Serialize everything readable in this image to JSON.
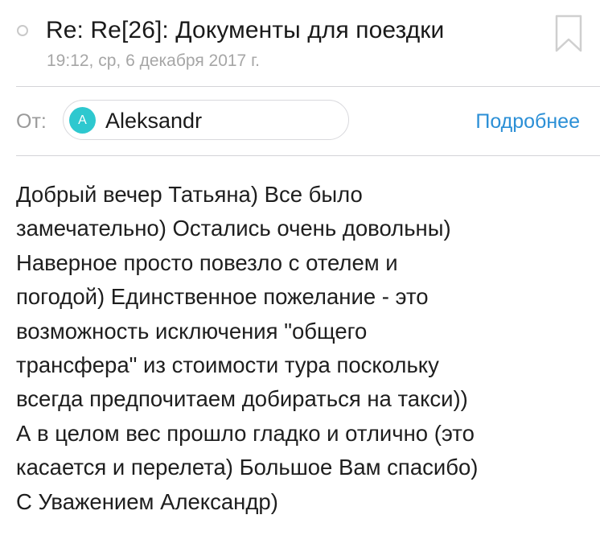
{
  "message": {
    "subject": "Re: Re[26]: Документы для поездки",
    "date": "19:12, ср, 6 декабря 2017 г."
  },
  "sender": {
    "from_label": "От:",
    "avatar_initial": "A",
    "name": "Aleksandr",
    "details_link": "Подробнее"
  },
  "icons": {
    "read_status": "unread-circle-icon",
    "bookmark": "bookmark-icon"
  },
  "colors": {
    "avatar": "#2ec8cf",
    "link": "#2b8fd6",
    "secondary_text": "#a6a6a6"
  },
  "body": {
    "lines": [
      "Добрый вечер Татьяна) Все было",
      "замечательно) Остались очень довольны)",
      "Наверное просто повезло с отелем и",
      "погодой) Единственное пожелание - это",
      "возможность исключения \"общего",
      "трансфера\" из стоимости тура поскольку",
      "всегда предпочитаем добираться на такси))",
      "А в целом вес прошло гладко и отлично (это",
      "касается и перелета) Большое Вам спасибо)",
      "С Уважением Александр)"
    ]
  }
}
